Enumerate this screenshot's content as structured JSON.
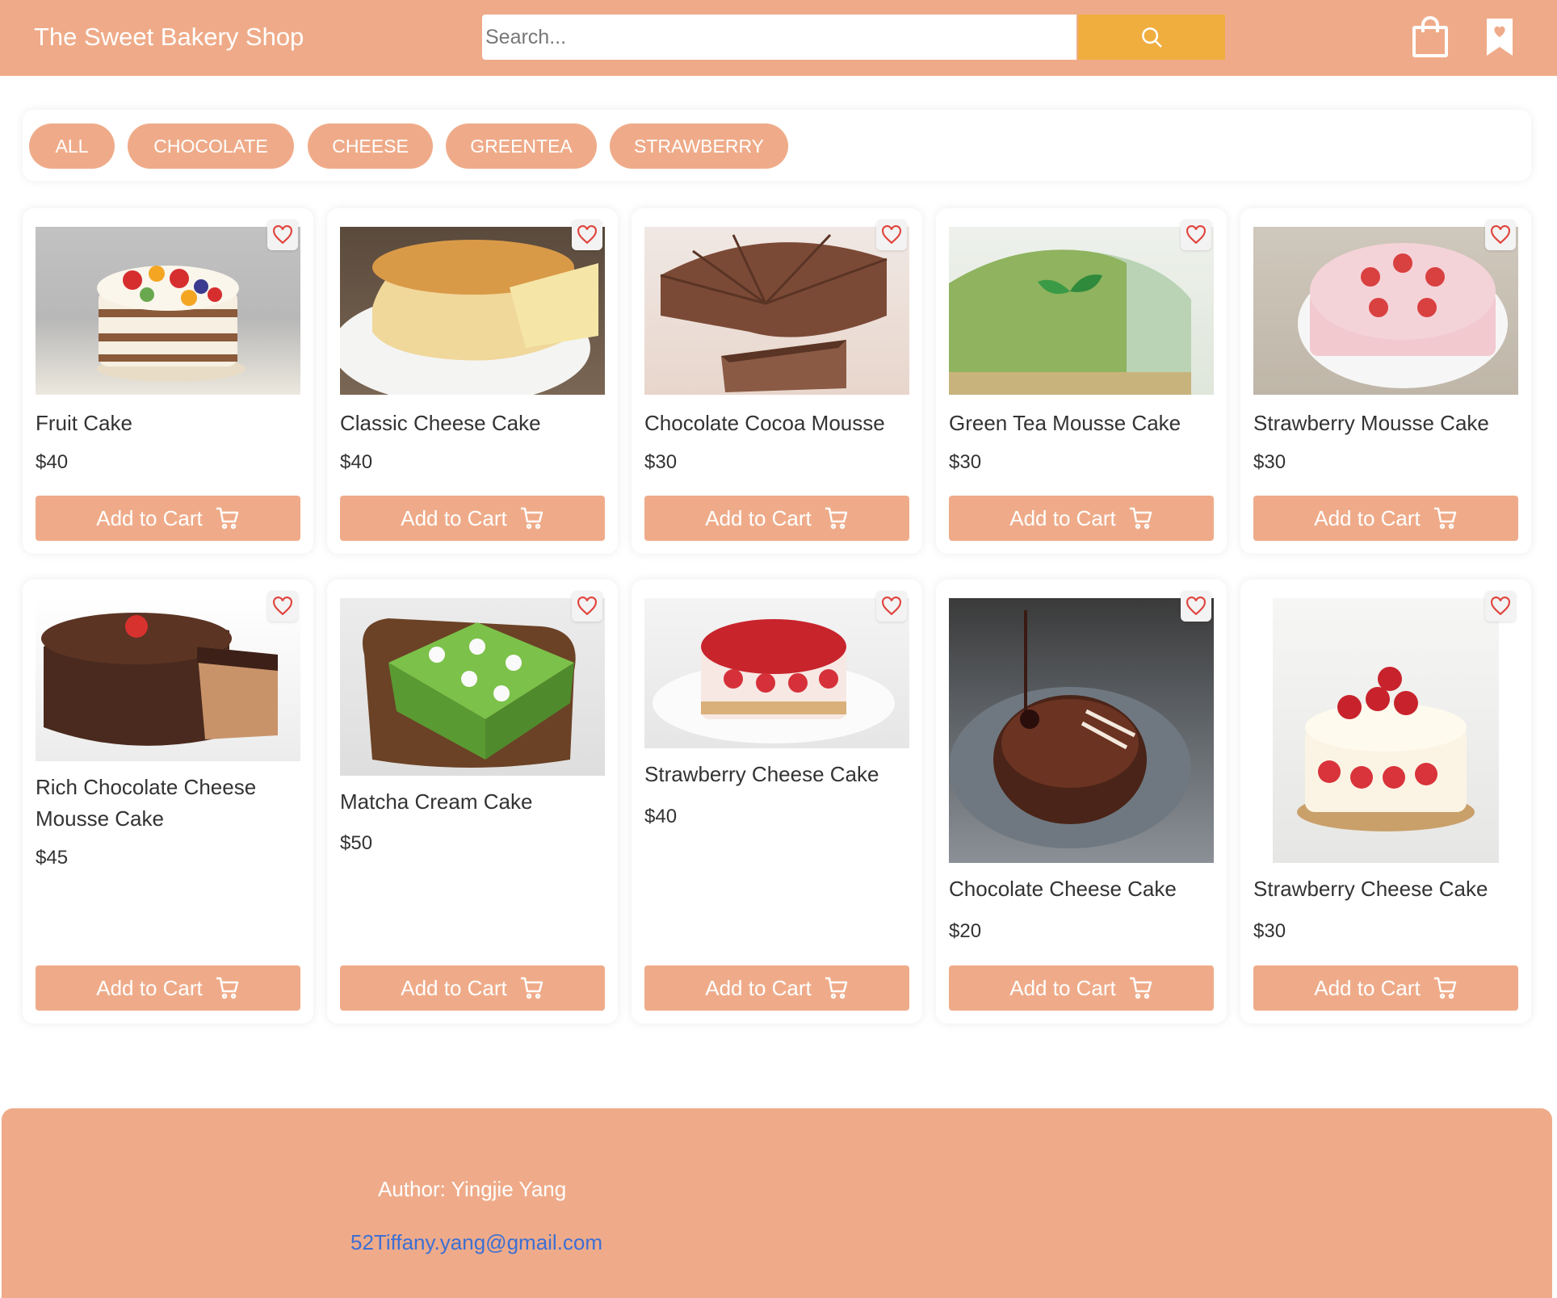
{
  "header": {
    "brand": "The Sweet Bakery Shop",
    "search_placeholder": "Search...",
    "search_icon": "search-icon",
    "cart_icon": "shopping-bag-icon",
    "favorites_icon": "bookmark-heart-icon"
  },
  "filters": [
    "ALL",
    "CHOCOLATE",
    "CHEESE",
    "GREENTEA",
    "STRAWBERRY"
  ],
  "products": [
    {
      "name": "Fruit Cake",
      "price": "$40",
      "add_label": "Add to Cart"
    },
    {
      "name": "Classic Cheese Cake",
      "price": "$40",
      "add_label": "Add to Cart"
    },
    {
      "name": "Chocolate Cocoa Mousse",
      "price": "$30",
      "add_label": "Add to Cart"
    },
    {
      "name": "Green Tea Mousse Cake",
      "price": "$30",
      "add_label": "Add to Cart"
    },
    {
      "name": "Strawberry Mousse Cake",
      "price": "$30",
      "add_label": "Add to Cart"
    },
    {
      "name": "Rich Chocolate Cheese Mousse Cake",
      "price": "$45",
      "add_label": "Add to Cart"
    },
    {
      "name": "Matcha Cream Cake",
      "price": "$50",
      "add_label": "Add to Cart"
    },
    {
      "name": "Strawberry Cheese Cake",
      "price": "$40",
      "add_label": "Add to Cart"
    },
    {
      "name": "Chocolate Cheese Cake",
      "price": "$20",
      "add_label": "Add to Cart"
    },
    {
      "name": "Strawberry Cheese Cake",
      "price": "$30",
      "add_label": "Add to Cart"
    }
  ],
  "footer": {
    "author": "Author: Yingjie Yang",
    "email": "52Tiffany.yang@gmail.com"
  },
  "colors": {
    "accent": "#efab89",
    "search_button": "#f0ae3f",
    "heart": "#e0453e",
    "link": "#3e6fd3"
  }
}
